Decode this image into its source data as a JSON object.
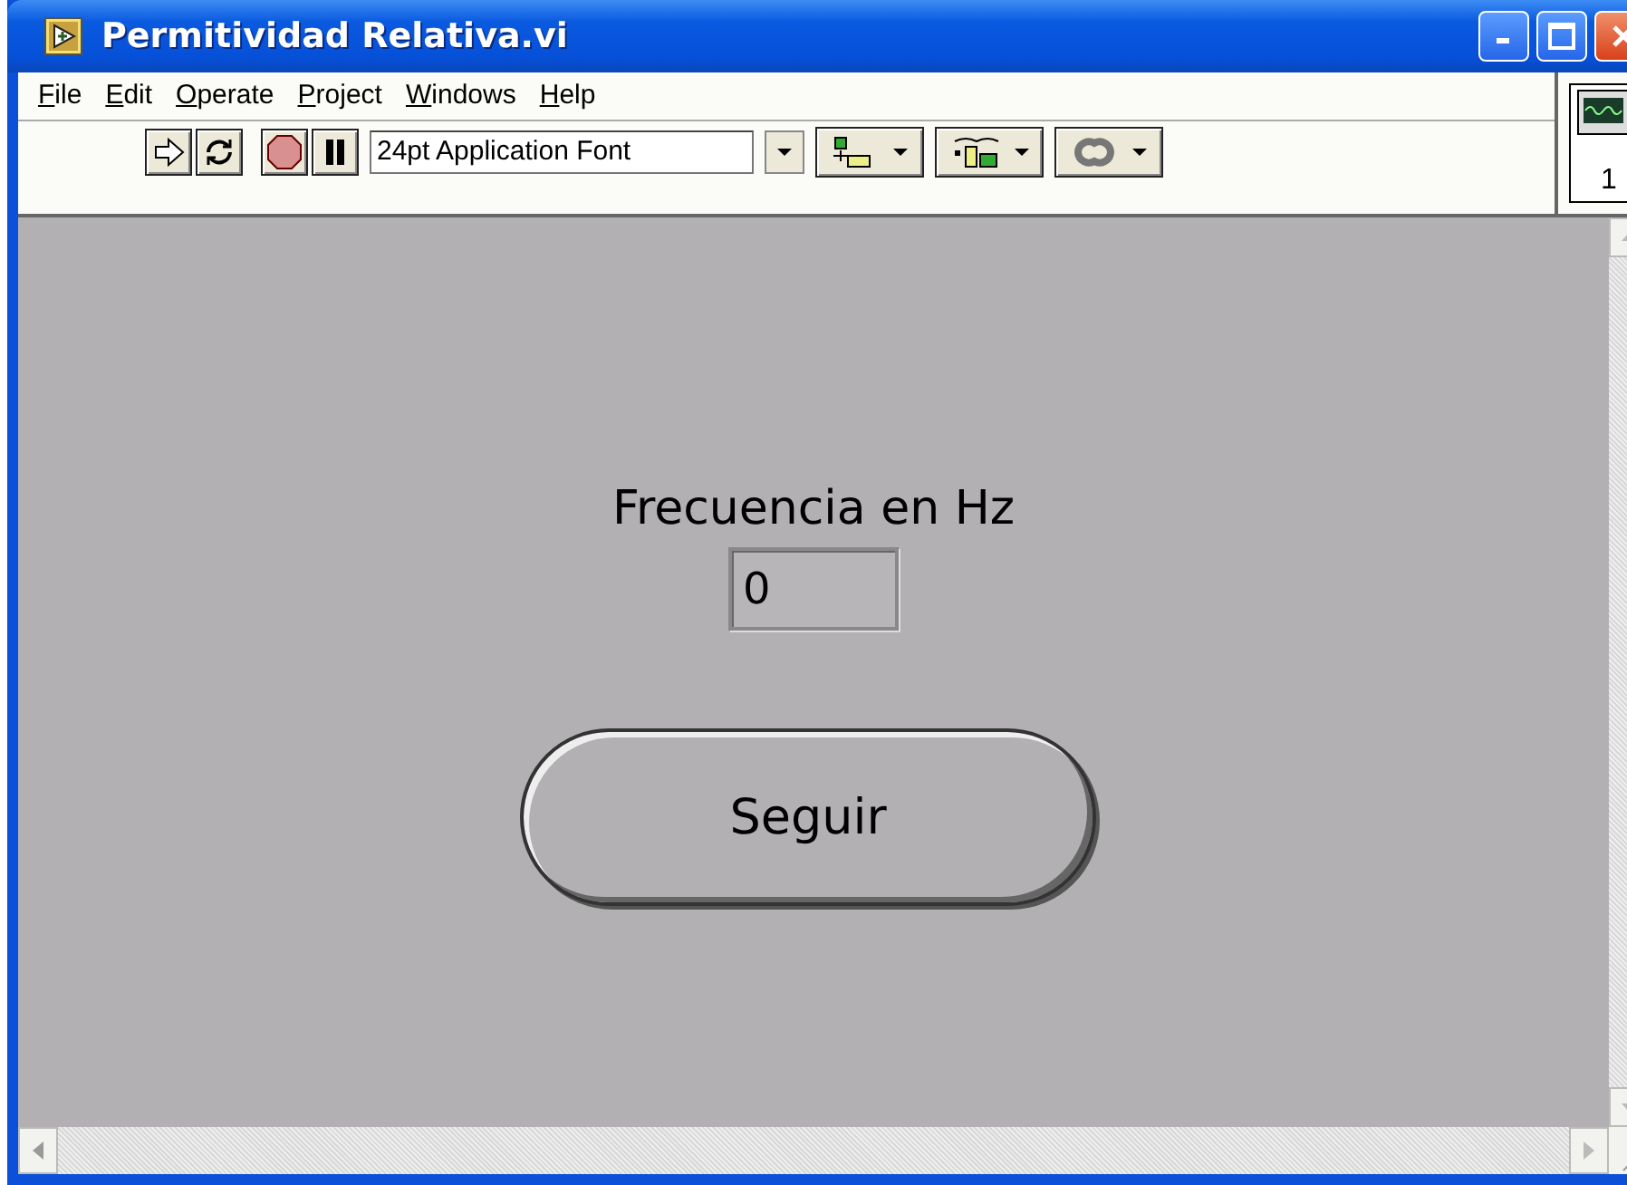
{
  "window": {
    "title": "Permitividad Relativa.vi"
  },
  "menu": [
    {
      "label": "File",
      "first_letter_underlined": true
    },
    {
      "label": "Edit",
      "first_letter_underlined": true
    },
    {
      "label": "Operate",
      "first_letter_underlined": true
    },
    {
      "label": "Project",
      "first_letter_underlined": true
    },
    {
      "label": "Windows",
      "first_letter_underlined": true
    },
    {
      "label": "Help",
      "first_letter_underlined": true
    }
  ],
  "toolbar": {
    "font_selector": "24pt Application Font"
  },
  "connector_pane": {
    "label": "1"
  },
  "panel": {
    "numeric": {
      "label": "Frecuencia en Hz",
      "value": "0"
    },
    "button": {
      "label": "Seguir"
    }
  }
}
